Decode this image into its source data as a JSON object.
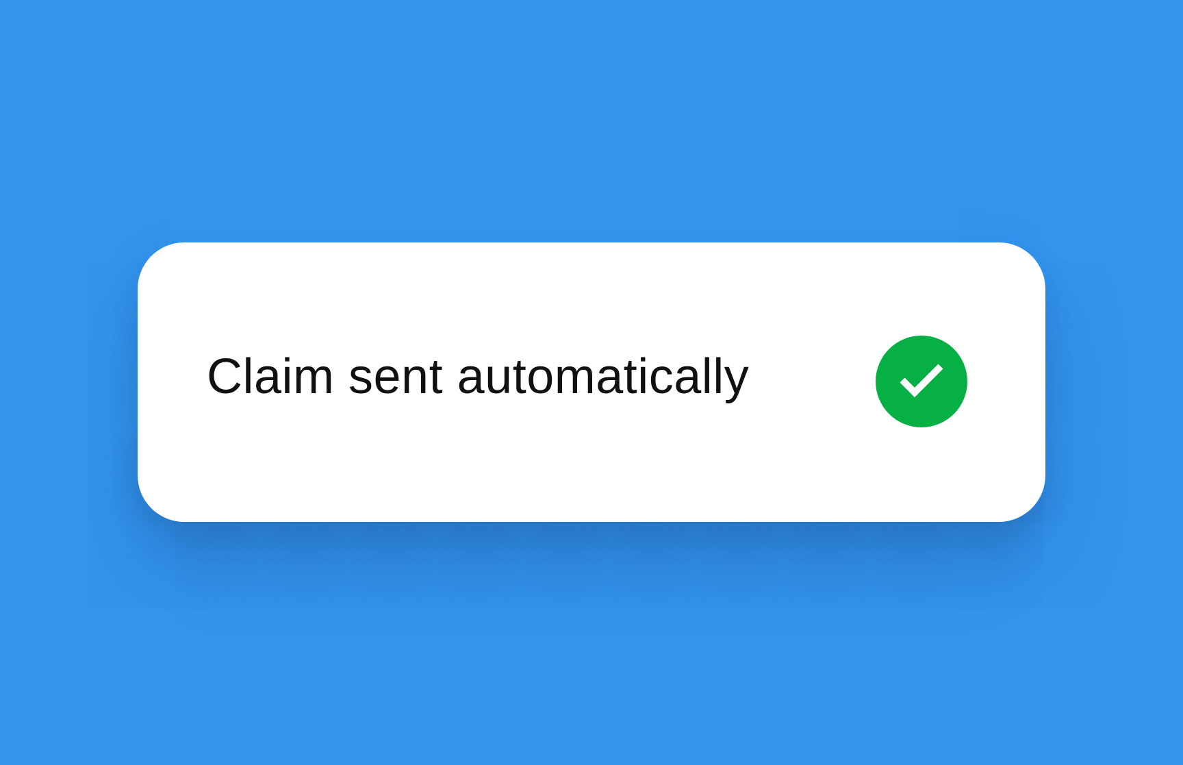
{
  "colors": {
    "background": "#3395ee",
    "card": "#ffffff",
    "text": "#111111",
    "success": "#06b045",
    "check_mark": "#ffffff"
  },
  "card": {
    "message": "Claim sent automatically",
    "status_icon": "check-circle-icon"
  }
}
